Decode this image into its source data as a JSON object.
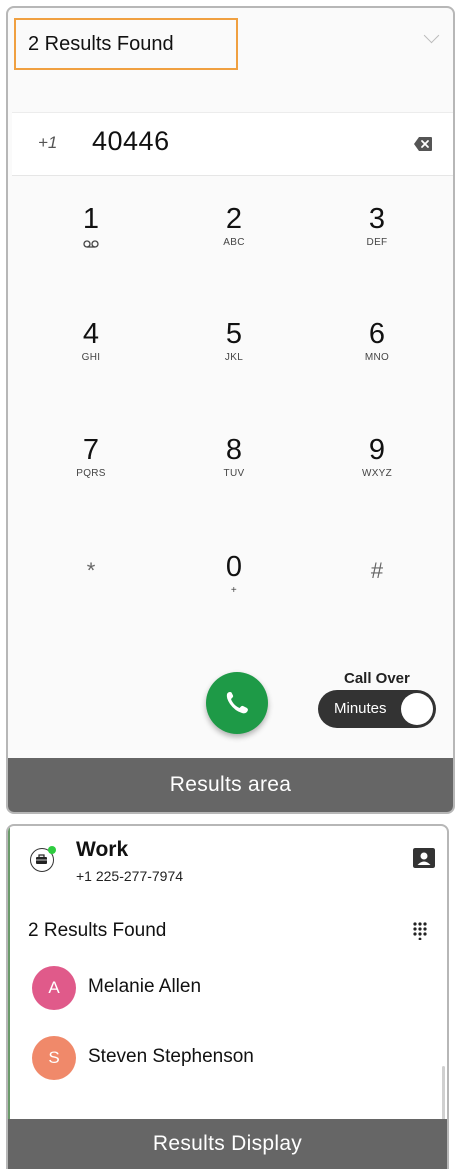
{
  "top_panel": {
    "results_header": "2 Results Found",
    "country_code": "+1",
    "dialed_number": "40446",
    "keys": [
      {
        "digit": "1",
        "sub": "voicemail",
        "icon": "voicemail-icon"
      },
      {
        "digit": "2",
        "sub": "ABC"
      },
      {
        "digit": "3",
        "sub": "DEF"
      },
      {
        "digit": "4",
        "sub": "GHI"
      },
      {
        "digit": "5",
        "sub": "JKL"
      },
      {
        "digit": "6",
        "sub": "MNO"
      },
      {
        "digit": "7",
        "sub": "PQRS"
      },
      {
        "digit": "8",
        "sub": "TUV"
      },
      {
        "digit": "9",
        "sub": "WXYZ"
      },
      {
        "digit": "*",
        "sub": ""
      },
      {
        "digit": "0",
        "sub": "+"
      },
      {
        "digit": "#",
        "sub": ""
      }
    ],
    "call_over_label": "Call Over",
    "toggle_label": "Minutes",
    "toggle_on": true,
    "caption": "Results area"
  },
  "bottom_panel": {
    "line_title": "Work",
    "line_number": "+1 225-277-7974",
    "results_found": "2 Results Found",
    "contacts": [
      {
        "initial": "A",
        "name": "Melanie Allen",
        "color": "#e05a8a"
      },
      {
        "initial": "S",
        "name": "Steven Stephenson",
        "color": "#f0896a"
      }
    ],
    "caption": "Results Display"
  },
  "colors": {
    "call_button": "#1e9a47",
    "highlight_border": "#f0a040",
    "caption_bg": "#666666"
  }
}
